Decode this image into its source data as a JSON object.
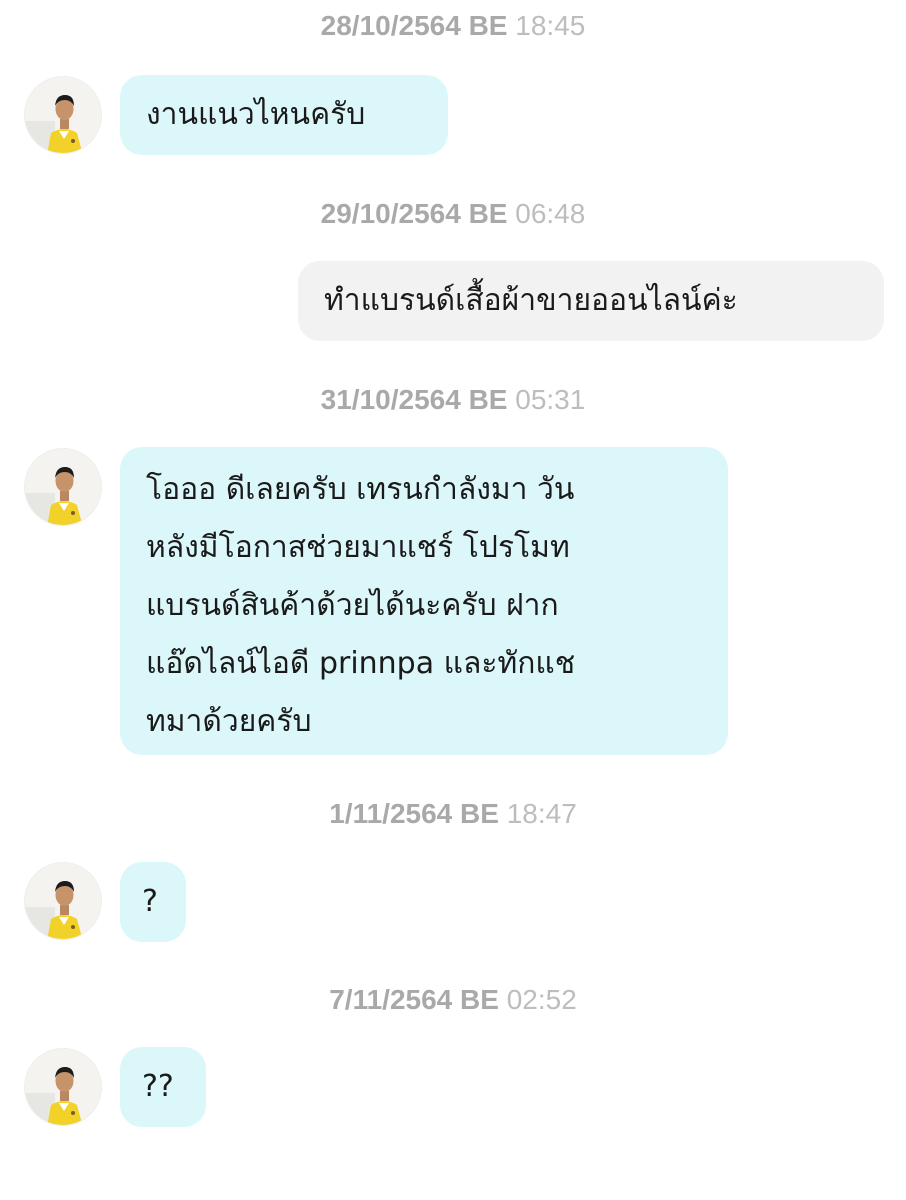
{
  "messages": [
    {
      "timestamp": {
        "date": "28/10/2564 BE",
        "time": "18:45"
      },
      "sender": "contact",
      "lines": [
        "งานแนวไหนครับ"
      ]
    },
    {
      "timestamp": {
        "date": "29/10/2564 BE",
        "time": "06:48"
      },
      "sender": "me",
      "lines": [
        "ทำแบรนด์เสื้อผ้าขายออนไลน์ค่ะ"
      ]
    },
    {
      "timestamp": {
        "date": "31/10/2564 BE",
        "time": "05:31"
      },
      "sender": "contact",
      "lines": [
        "โอออ ดีเลยครับ เทรนกำลังมา วัน",
        "หลังมีโอกาสช่วยมาแชร์ โปรโมท",
        "แบรนด์สินค้าด้วยได้นะครับ ฝาก",
        "แอ๊ดไลน์ไอดี prinnpa และทักแช",
        "ทมาด้วยครับ"
      ]
    },
    {
      "timestamp": {
        "date": "1/11/2564 BE",
        "time": "18:47"
      },
      "sender": "contact",
      "lines": [
        "?"
      ]
    },
    {
      "timestamp": {
        "date": "7/11/2564 BE",
        "time": "02:52"
      },
      "sender": "contact",
      "lines": [
        "??"
      ]
    }
  ],
  "colors": {
    "incoming_bubble": "#dcf7fa",
    "outgoing_bubble": "#f2f2f2",
    "timestamp": "#a9a9a9",
    "text": "#1a1a1a"
  },
  "icons": {
    "avatar": "contact-avatar-photo"
  }
}
